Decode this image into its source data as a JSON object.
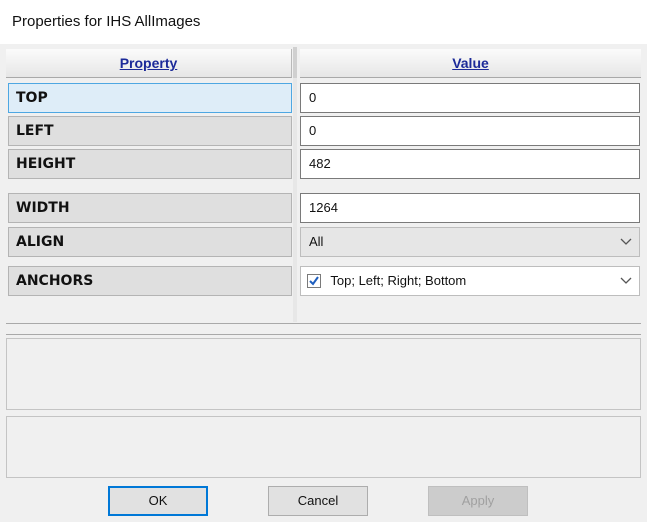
{
  "window": {
    "title": "Properties for IHS AllImages"
  },
  "grid": {
    "headers": {
      "property": "Property",
      "value": "Value"
    },
    "rows": [
      {
        "name": "TOP",
        "value": "0",
        "selected": true,
        "editor": "text"
      },
      {
        "name": "LEFT",
        "value": "0",
        "editor": "text"
      },
      {
        "name": "HEIGHT",
        "value": "482",
        "editor": "text"
      },
      {
        "name": "WIDTH",
        "value": "1264",
        "editor": "text"
      },
      {
        "name": "ALIGN",
        "value": "All",
        "editor": "dropdown"
      },
      {
        "name": "ANCHORS",
        "value": "Top; Left; Right; Bottom",
        "editor": "checkbox-dropdown",
        "checked": true
      }
    ]
  },
  "buttons": {
    "ok": "OK",
    "cancel": "Cancel",
    "apply": "Apply",
    "apply_enabled": false
  },
  "colors": {
    "header_text": "#1c2a99",
    "selected_row": "#deedf8",
    "selected_border": "#4ea7e2",
    "focus_border": "#0078d7"
  }
}
